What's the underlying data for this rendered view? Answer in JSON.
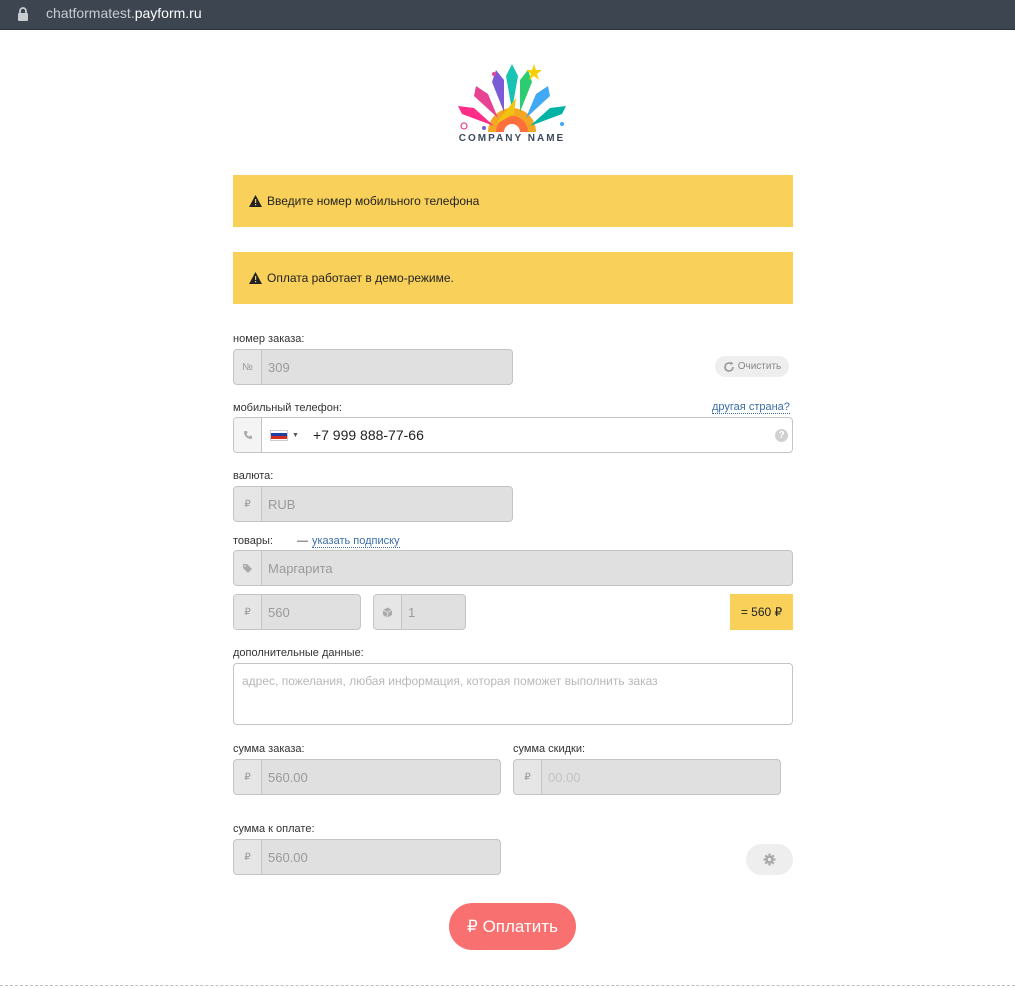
{
  "browser": {
    "url_prefix": "chatformatest.",
    "url_domain": "payform.ru"
  },
  "logo": {
    "text": "COMPANY NAME"
  },
  "alerts": [
    {
      "text": "Введите номер мобильного телефона"
    },
    {
      "text": "Оплата работает в демо-режиме."
    }
  ],
  "order": {
    "label": "номер заказа:",
    "prefix": "№",
    "value": "309",
    "clear_label": "Очистить"
  },
  "phone": {
    "label": "мобильный телефон:",
    "other_country": "другая страна?",
    "value": "+7 999 888-77-66",
    "help": "?"
  },
  "currency": {
    "label": "валюта:",
    "prefix": "₽",
    "value": "RUB"
  },
  "goods": {
    "label": "товары:",
    "subscription_dash": "—",
    "subscription_link": "указать подписку",
    "name": "Маргарита",
    "price_prefix": "₽",
    "price": "560",
    "qty": "1",
    "total": "= 560 ₽"
  },
  "extra": {
    "label": "дополнительные данные:",
    "placeholder": "адрес, пожелания, любая информация, которая поможет выполнить заказ"
  },
  "order_sum": {
    "label": "сумма заказа:",
    "prefix": "₽",
    "value": "560.00"
  },
  "discount": {
    "label": "сумма скидки:",
    "prefix": "₽",
    "value": "00.00"
  },
  "to_pay": {
    "label": "сумма к оплате:",
    "prefix": "₽",
    "value": "560.00"
  },
  "pay_button": {
    "label": "₽ Оплатить"
  },
  "colors": {
    "alert": "#f8d05a",
    "pay": "#f87070",
    "link": "#3a6fa8"
  }
}
